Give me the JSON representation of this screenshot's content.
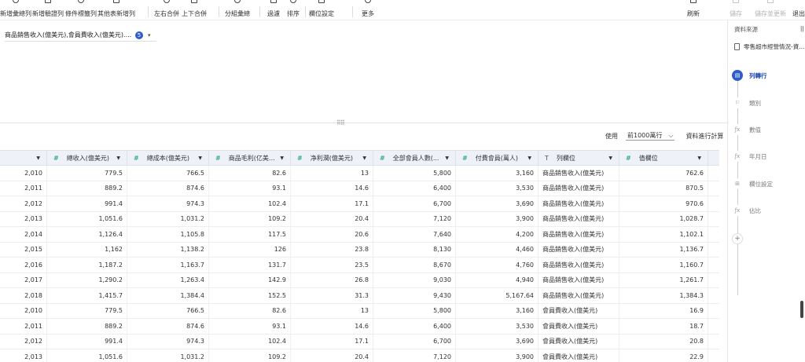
{
  "toolbar": {
    "left": [
      {
        "label": "新增彙總列",
        "name": "add-summary-row-button"
      },
      {
        "label": "新增驗證列",
        "name": "add-validation-row-button"
      },
      {
        "label": "條件標籤列",
        "name": "conditional-tag-row-button"
      },
      {
        "label": "其他表新增列",
        "name": "add-row-from-other-table-button"
      },
      {
        "label": "左右合併",
        "name": "merge-left-right-button"
      },
      {
        "label": "上下合併",
        "name": "merge-top-bottom-button"
      },
      {
        "label": "分組彙總",
        "name": "group-summary-button"
      },
      {
        "label": "過濾",
        "name": "filter-button"
      },
      {
        "label": "排序",
        "name": "sort-button"
      },
      {
        "label": "欄位設定",
        "name": "field-settings-button"
      },
      {
        "label": "更多",
        "name": "more-button"
      }
    ],
    "right": [
      {
        "label": "刷新",
        "name": "refresh-button"
      },
      {
        "label": "儲存",
        "name": "save-button"
      },
      {
        "label": "儲存並更新",
        "name": "save-and-update-button"
      },
      {
        "label": "退出並預覽",
        "name": "exit-preview-button"
      }
    ]
  },
  "filter": {
    "text": "商品銷售收入(億美元),會員費收入(億美元)....",
    "count": "5"
  },
  "table_controls": {
    "use_label": "使用",
    "row_option": "前1000萬行",
    "calc_label": "資料進行計算"
  },
  "columns": [
    {
      "type": "#",
      "label": ""
    },
    {
      "type": "#",
      "label": "總收入(億美元)"
    },
    {
      "type": "#",
      "label": "總成本(億美元)"
    },
    {
      "type": "#",
      "label": "商品毛利(亿美元)"
    },
    {
      "type": "#",
      "label": "净利潤(億美元)"
    },
    {
      "type": "#",
      "label": "全部會員人數(..."
    },
    {
      "type": "#",
      "label": "付費會員(萬人)"
    },
    {
      "type": "T",
      "label": "列欄位"
    },
    {
      "type": "#",
      "label": "值欄位"
    }
  ],
  "rows": [
    [
      "2,010",
      "779.5",
      "766.5",
      "82.6",
      "13",
      "5,800",
      "3,160",
      "商品銷售收入(億美元)",
      "762.6"
    ],
    [
      "2,011",
      "889.2",
      "874.6",
      "93.1",
      "14.6",
      "6,400",
      "3,530",
      "商品銷售收入(億美元)",
      "870.5"
    ],
    [
      "2,012",
      "991.4",
      "974.3",
      "102.4",
      "17.1",
      "6,700",
      "3,690",
      "商品銷售收入(億美元)",
      "970.6"
    ],
    [
      "2,013",
      "1,051.6",
      "1,031.2",
      "109.2",
      "20.4",
      "7,120",
      "3,900",
      "商品銷售收入(億美元)",
      "1,028.7"
    ],
    [
      "2,014",
      "1,126.4",
      "1,105.8",
      "117.5",
      "20.6",
      "7,640",
      "4,200",
      "商品銷售收入(億美元)",
      "1,102.1"
    ],
    [
      "2,015",
      "1,162",
      "1,138.2",
      "126",
      "23.8",
      "8,130",
      "4,460",
      "商品銷售收入(億美元)",
      "1,136.7"
    ],
    [
      "2,016",
      "1,187.2",
      "1,163.7",
      "131.7",
      "23.5",
      "8,670",
      "4,760",
      "商品銷售收入(億美元)",
      "1,160.7"
    ],
    [
      "2,017",
      "1,290.2",
      "1,263.4",
      "142.9",
      "26.8",
      "9,030",
      "4,940",
      "商品銷售收入(億美元)",
      "1,261.7"
    ],
    [
      "2,018",
      "1,415.7",
      "1,384.4",
      "152.5",
      "31.3",
      "9,430",
      "5,167.64",
      "商品銷售收入(億美元)",
      "1,384.3"
    ],
    [
      "2,010",
      "779.5",
      "766.5",
      "82.6",
      "13",
      "5,800",
      "3,160",
      "會員費收入(億美元)",
      "16.9"
    ],
    [
      "2,011",
      "889.2",
      "874.6",
      "93.1",
      "14.6",
      "6,400",
      "3,530",
      "會員費收入(億美元)",
      "18.7"
    ],
    [
      "2,012",
      "991.4",
      "974.3",
      "102.4",
      "17.1",
      "6,700",
      "3,690",
      "會員費收入(億美元)",
      "20.8"
    ],
    [
      "2,013",
      "1,051.6",
      "1,031.2",
      "109.2",
      "20.4",
      "7,120",
      "3,900",
      "會員費收入(億美元)",
      "22.9"
    ]
  ],
  "right_panel": {
    "header": "資料來源",
    "source": "零售超市經營情況-資...",
    "steps": [
      {
        "label": "列轉行",
        "icon": "table-icon",
        "active": true
      },
      {
        "label": "類別",
        "icon": "flag-icon",
        "active": false
      },
      {
        "label": "數值",
        "icon": "fx-icon",
        "active": false
      },
      {
        "label": "年月日",
        "icon": "fx-icon",
        "active": false
      },
      {
        "label": "欄位設定",
        "icon": "field-settings-icon",
        "active": false
      },
      {
        "label": "佔比",
        "icon": "fx-icon",
        "active": false
      }
    ]
  }
}
